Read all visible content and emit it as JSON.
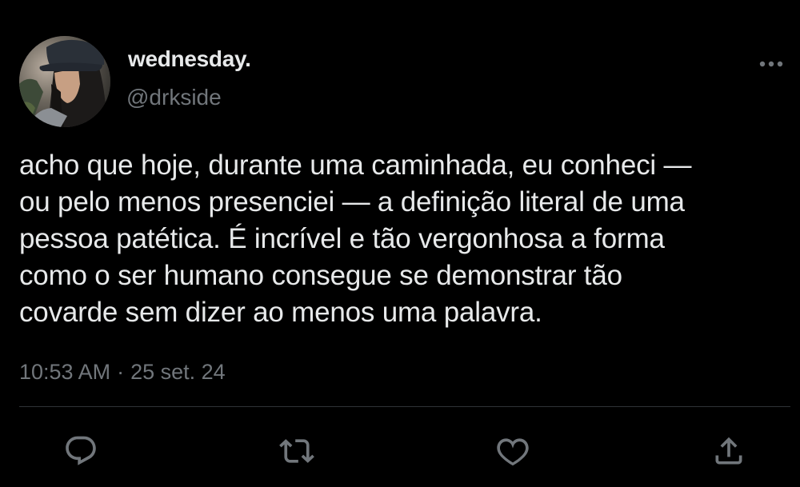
{
  "tweet": {
    "author": {
      "display_name": "wednesday.",
      "handle": "@drkside"
    },
    "text": "acho que hoje, durante uma caminhada, eu conheci —\nou pelo menos presenciei — a definição literal de uma\npessoa patética. É incrível e tão vergonhosa a forma\ncomo o ser humano consegue se demonstrar tão\ncovarde sem dizer ao menos uma palavra.",
    "time": "10:53 AM",
    "separator": "·",
    "date": "25 set. 24"
  },
  "icons": {
    "more": "more-options-icon",
    "reply": "reply-icon",
    "retweet": "retweet-icon",
    "like": "heart-icon",
    "share": "share-icon"
  },
  "colors": {
    "background": "#000000",
    "text_primary": "#e7e9ea",
    "text_secondary": "#71767b",
    "divider": "#2f3336"
  }
}
